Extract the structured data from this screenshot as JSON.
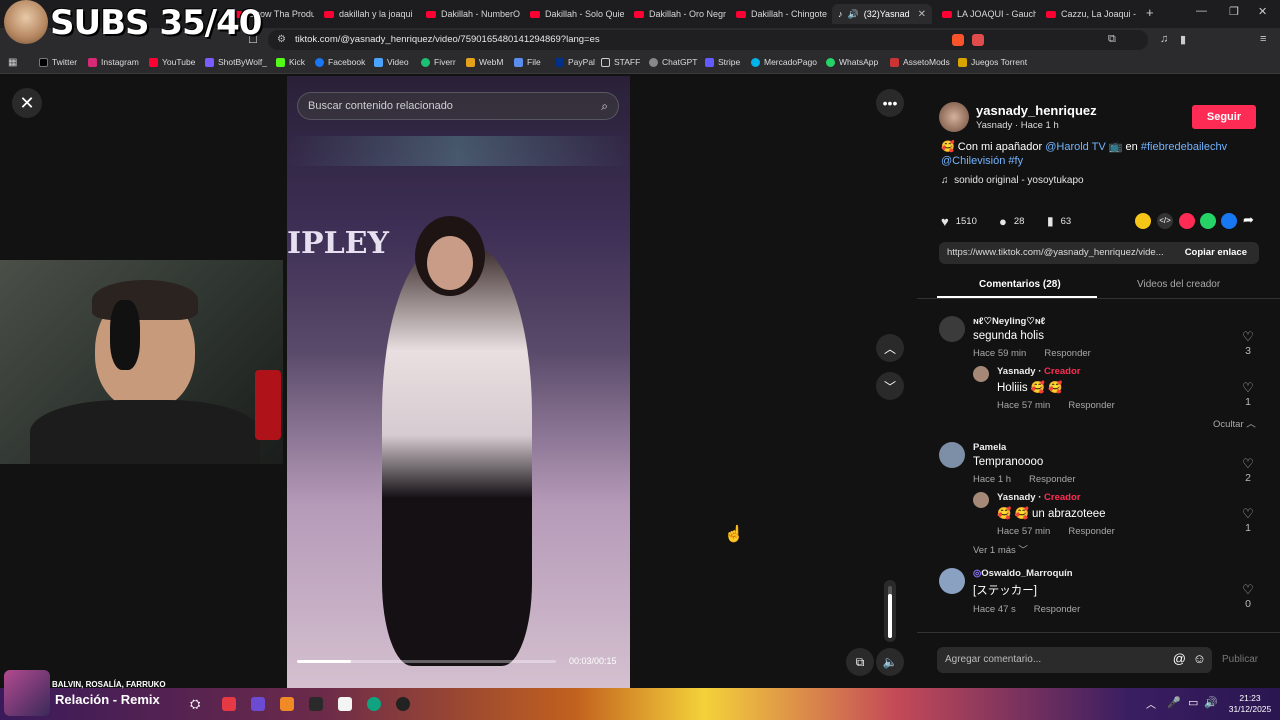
{
  "overlay": {
    "subs_label": "SUBS 35/40"
  },
  "tabs": [
    {
      "label": "Snow Tha Product",
      "active": false
    },
    {
      "label": "dakillah y la joaqui",
      "active": false
    },
    {
      "label": "Dakillah - NumberO",
      "active": false
    },
    {
      "label": "Dakillah - Solo Quie",
      "active": false
    },
    {
      "label": "Dakillah - Oro Negr",
      "active": false
    },
    {
      "label": "Dakillah - Chingote",
      "active": false
    },
    {
      "label": "(32)Yasnad",
      "active": true
    },
    {
      "label": "LA JOAQUI - Gauch",
      "active": false
    },
    {
      "label": "Cazzu, La Joaqui - A",
      "active": false
    }
  ],
  "address": {
    "url": "tiktok.com/@yasnady_henriquez/video/7590165480141294869?lang=es"
  },
  "bookmarks": [
    "Twitter",
    "Instagram",
    "YouTube",
    "ShotByWolf_",
    "Kick",
    "Facebook",
    "Video",
    "Fiverr",
    "WebM",
    "File",
    "PayPal",
    "STAFF",
    "ChatGPT",
    "Stripe",
    "MercadoPago",
    "WhatsApp",
    "AssetoMods",
    "Juegos Torrent"
  ],
  "video": {
    "search_placeholder": "Buscar contenido relacionado",
    "time": "00:03/00:15",
    "progress": 0.21,
    "volume": 0.85
  },
  "author": {
    "username": "yasnady_henriquez",
    "subtitle": "Yasnady · Hace 1 h",
    "follow_label": "Seguir",
    "caption_text": "Con mi apañador",
    "mention": "@Harold TV",
    "caption_mid": "en",
    "hashtag1": "#fiebredebailechv",
    "mention2": "@Chilevisión",
    "hashtag2": "#fy",
    "sound": "sonido original - yosoytukapo"
  },
  "stats": {
    "likes": "1510",
    "comments": "28",
    "saves": "63"
  },
  "link_box": {
    "url": "https://www.tiktok.com/@yasnady_henriquez/vide...",
    "copy_label": "Copiar enlace"
  },
  "panel_tabs": {
    "comments": "Comentarios (28)",
    "creator_videos": "Videos del creador"
  },
  "comments": [
    {
      "user": "ɴℓ♡Neyling♡ɴℓ",
      "text": "segunda holis",
      "time": "Hace 59 min",
      "reply": "Responder",
      "likes": "3"
    },
    {
      "user": "Yasnady",
      "badge": "Creador",
      "text": "Holiiis 🥰 🥰",
      "time": "Hace 57 min",
      "reply": "Responder",
      "likes": "1"
    },
    {
      "user": "Pamela",
      "text": "Tempranoooo",
      "time": "Hace 1 h",
      "reply": "Responder",
      "likes": "2"
    },
    {
      "user": "Yasnady",
      "badge": "Creador",
      "text": "🥰 🥰 un abrazoteee",
      "time": "Hace 57 min",
      "reply": "Responder",
      "likes": "1"
    },
    {
      "user": "Oswaldo_Marroquín",
      "text": "[ステッカー]",
      "time": "Hace 47 s",
      "reply": "Responder",
      "likes": "0"
    }
  ],
  "hide_label": "Ocultar",
  "more_label": "Ver 1 más",
  "comment_input": {
    "placeholder": "Agregar comentario...",
    "publish": "Publicar"
  },
  "music_widget": {
    "artist": "BALVIN, ROSALÍA, FARRUKO",
    "title": "Relación - Remix"
  },
  "clock": {
    "time": "21:23",
    "date": "31/12/2025"
  },
  "colors": {
    "follow": "#fe2c55",
    "creator": "#fe2c55",
    "link": "#73b4ff"
  }
}
